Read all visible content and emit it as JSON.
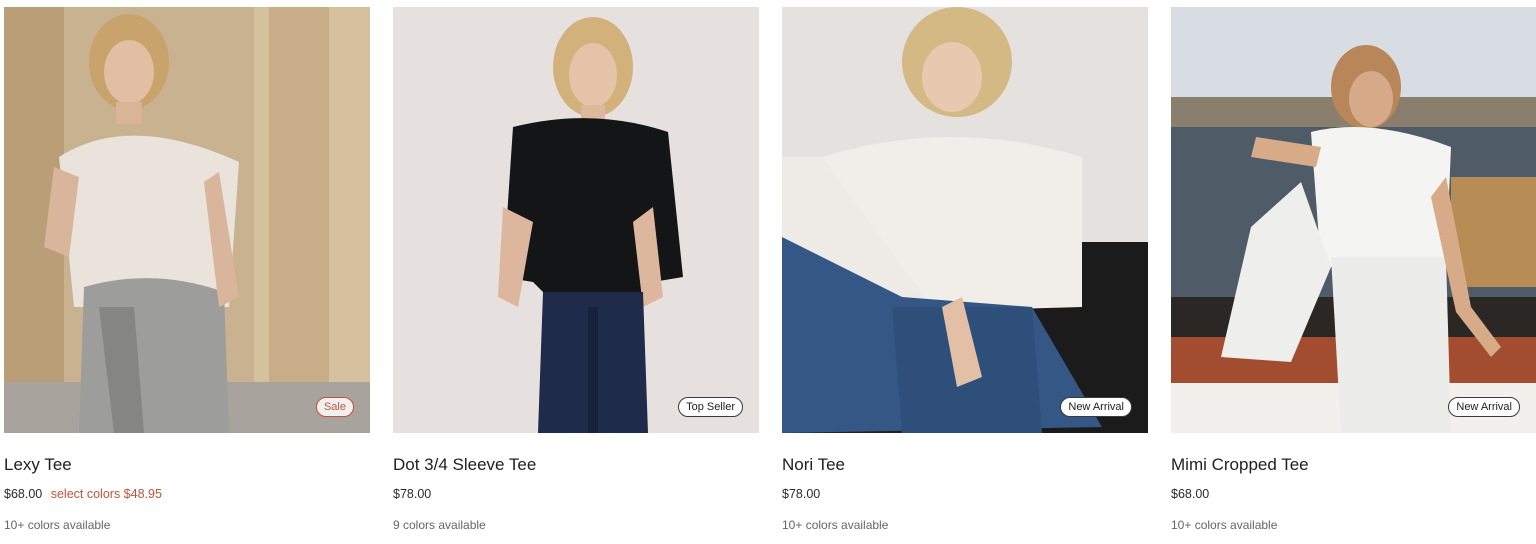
{
  "products": [
    {
      "name": "Lexy Tee",
      "price": "$68.00",
      "sale_text": "select colors $48.95",
      "colors": "10+ colors available",
      "badge": "Sale"
    },
    {
      "name": "Dot 3/4 Sleeve Tee",
      "price": "$78.00",
      "sale_text": "",
      "colors": "9 colors available",
      "badge": "Top Seller"
    },
    {
      "name": "Nori Tee",
      "price": "$78.00",
      "sale_text": "",
      "colors": "10+ colors available",
      "badge": "New Arrival"
    },
    {
      "name": "Mimi Cropped Tee",
      "price": "$68.00",
      "sale_text": "",
      "colors": "10+ colors available",
      "badge": "New Arrival"
    }
  ],
  "colors": {
    "sale_accent": "#c0533f",
    "text_primary": "#1f1f1f",
    "text_secondary": "#666666"
  }
}
